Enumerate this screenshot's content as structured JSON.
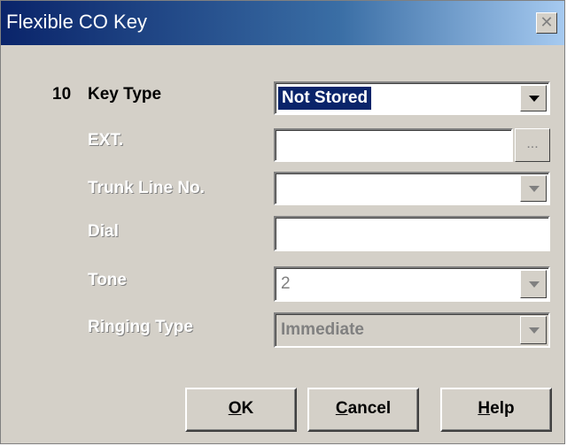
{
  "window": {
    "title": "Flexible CO Key",
    "close_glyph": "✕"
  },
  "form": {
    "index": "10",
    "key_type": {
      "label": "Key Type",
      "value": "Not Stored"
    },
    "ext": {
      "label": "EXT.",
      "value": "",
      "browse_label": "..."
    },
    "trunk_line": {
      "label": "Trunk Line No.",
      "value": ""
    },
    "dial": {
      "label": "Dial",
      "value": ""
    },
    "tone": {
      "label": "Tone",
      "value": "2"
    },
    "ringing_type": {
      "label": "Ringing Type",
      "value": "Immediate"
    }
  },
  "buttons": {
    "ok": {
      "accel": "O",
      "rest": "K"
    },
    "cancel": {
      "accel": "C",
      "rest": "ancel"
    },
    "help": {
      "accel": "H",
      "rest": "elp"
    }
  },
  "icons": [
    "close-icon",
    "dropdown-arrow-icon",
    "ellipsis-icon"
  ],
  "colors": {
    "title_start": "#0a246a",
    "title_end": "#a6caf0",
    "face": "#d4d0c8",
    "selection": "#0a246a"
  }
}
